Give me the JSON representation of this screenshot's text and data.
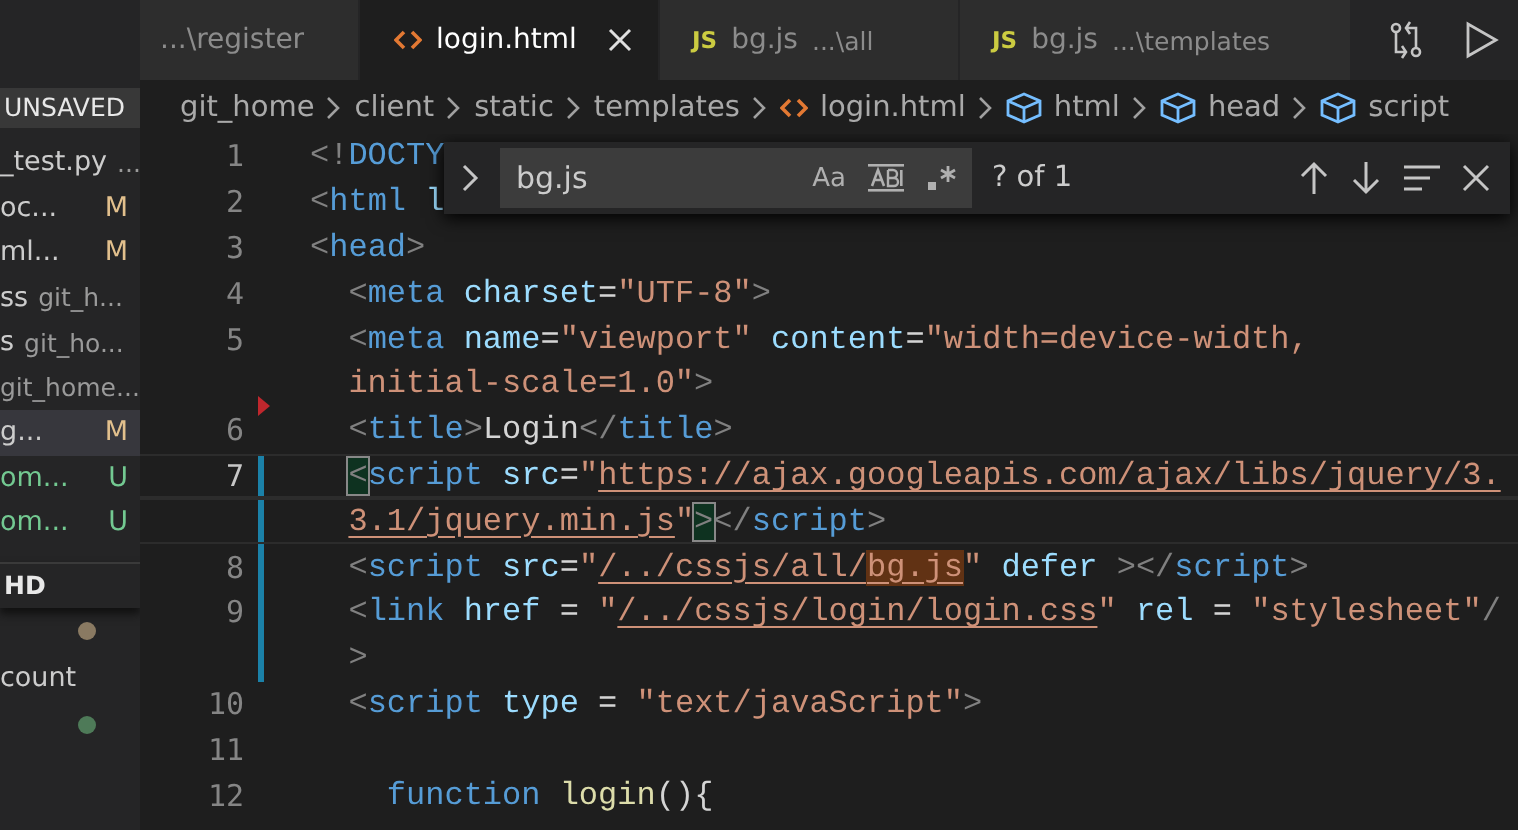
{
  "sidebar": {
    "items": [
      {
        "kind": "header",
        "label": "UNSAVED"
      },
      {
        "kind": "file",
        "label": "_test.py",
        "description": "...",
        "selected": false
      },
      {
        "kind": "file",
        "label": "oc...",
        "badge": "M",
        "color": "#e2c08d",
        "selected": false
      },
      {
        "kind": "file",
        "label": "ml...",
        "badge": "M",
        "color": "#e2c08d",
        "selected": false
      },
      {
        "kind": "file",
        "label": "ss",
        "description": "git_h...",
        "selected": false
      },
      {
        "kind": "file",
        "label": "s",
        "description": "git_ho...",
        "selected": false
      },
      {
        "kind": "file",
        "description": "git_home...",
        "selected": false
      },
      {
        "kind": "file",
        "label": "g...",
        "badge": "M",
        "color": "#e2c08d",
        "selected": true
      },
      {
        "kind": "file",
        "label": "om...",
        "badge": "U",
        "color": "#73c991",
        "selected": false
      },
      {
        "kind": "file",
        "label": "om...",
        "badge": "U",
        "color": "#73c991",
        "selected": false
      },
      {
        "kind": "header",
        "label": "HD"
      },
      {
        "kind": "dot",
        "color": "#8a7a62"
      },
      {
        "kind": "file",
        "label": "count",
        "selected": false
      },
      {
        "kind": "dot",
        "color": "#4e7a58"
      }
    ]
  },
  "tabs": [
    {
      "kind": "plain",
      "label": "...\\register",
      "selected": false,
      "closable": false
    },
    {
      "kind": "html",
      "label": "login.html",
      "selected": true,
      "closable": true
    },
    {
      "kind": "js",
      "icon_text": "JS",
      "label": "bg.js",
      "description": "...\\all",
      "selected": false,
      "closable": false
    },
    {
      "kind": "js",
      "icon_text": "JS",
      "label": "bg.js",
      "description": "...\\templates",
      "selected": false,
      "closable": false
    }
  ],
  "breadcrumbs": [
    {
      "kind": "folder",
      "label": "git_home"
    },
    {
      "kind": "folder",
      "label": "client"
    },
    {
      "kind": "folder",
      "label": "static"
    },
    {
      "kind": "folder",
      "label": "templates"
    },
    {
      "kind": "html",
      "label": "login.html"
    },
    {
      "kind": "symbol",
      "label": "html"
    },
    {
      "kind": "symbol",
      "label": "head"
    },
    {
      "kind": "symbol",
      "label": "script"
    }
  ],
  "find_widget": {
    "value": "bg.js",
    "options": [
      {
        "kind": "match-case",
        "label": "Aa",
        "on": false
      },
      {
        "kind": "whole-word",
        "on": false
      },
      {
        "kind": "regex",
        "on": false
      }
    ],
    "result": "? of 1"
  },
  "code_lines": [
    {
      "number": "1",
      "current": false,
      "modified": false,
      "deleted_above": false,
      "rows": [
        {
          "segments": [
            {
              "text": "<!DOCTY"
            }
          ]
        }
      ]
    },
    {
      "number": "2",
      "current": false,
      "modified": false,
      "deleted_above": false,
      "rows": [
        {
          "segments": [
            {
              "text": "<html l"
            }
          ]
        }
      ]
    },
    {
      "number": "3",
      "current": false,
      "modified": false,
      "deleted_above": false,
      "rows": [
        {
          "segments": [
            {
              "text": "<head>"
            }
          ]
        }
      ]
    },
    {
      "number": "4",
      "current": false,
      "modified": false,
      "deleted_above": false,
      "rows": [
        {
          "segments": [
            {
              "text": "  <meta charset=\"UTF-8\">"
            }
          ]
        }
      ]
    },
    {
      "number": "5",
      "current": false,
      "modified": false,
      "deleted_above": false,
      "rows": [
        {
          "segments": [
            {
              "text": "  <meta name=\"viewport\" content=\"width=device-width,"
            }
          ]
        },
        {
          "segments": [
            {
              "text": "  initial-scale=1.0\">"
            }
          ]
        }
      ]
    },
    {
      "number": "6",
      "current": false,
      "modified": false,
      "deleted_above": true,
      "rows": [
        {
          "segments": [
            {
              "text": "  <title>Login</title>"
            }
          ]
        }
      ]
    },
    {
      "number": "7",
      "current": true,
      "modified": true,
      "deleted_above": false,
      "rows": [
        {
          "segments": [
            {
              "text": "  <",
              "bracket_match": true
            },
            {
              "text": "script src=\""
            },
            {
              "text": "https://ajax.googleapis.com/ajax/libs/jquery/3.",
              "link": true
            }
          ]
        },
        {
          "segments": [
            {
              "text": "  3.1/jquery.min.js",
              "link": true
            },
            {
              "text": "\""
            },
            {
              "text": ">",
              "bracket_match": true
            },
            {
              "text": "</script>"
            }
          ]
        }
      ]
    },
    {
      "number": "8",
      "current": false,
      "modified": true,
      "deleted_above": false,
      "rows": [
        {
          "segments": [
            {
              "text": "  <script src=\""
            },
            {
              "text": "/../cssjs/all/",
              "link": true
            },
            {
              "text": "bg.js",
              "link": true,
              "match": true
            },
            {
              "text": "\" defer ></script>"
            }
          ]
        }
      ]
    },
    {
      "number": "9",
      "current": false,
      "modified": true,
      "deleted_above": false,
      "rows": [
        {
          "segments": [
            {
              "text": "  <link href = \""
            },
            {
              "text": "/../cssjs/login/login.css",
              "link": true
            },
            {
              "text": "\" rel = \"stylesheet\"/"
            }
          ]
        },
        {
          "segments": [
            {
              "text": "  >"
            }
          ]
        }
      ]
    },
    {
      "number": "10",
      "current": false,
      "modified": false,
      "deleted_above": false,
      "rows": [
        {
          "segments": [
            {
              "text": "  <script type = \"text/javaScript\">"
            }
          ]
        }
      ]
    },
    {
      "number": "11",
      "current": false,
      "modified": false,
      "deleted_above": false,
      "rows": [
        {}
      ]
    },
    {
      "number": "12",
      "current": false,
      "modified": false,
      "deleted_above": false,
      "rows": [
        {
          "segments": [
            {
              "text": "    function login(){"
            }
          ]
        }
      ]
    }
  ]
}
